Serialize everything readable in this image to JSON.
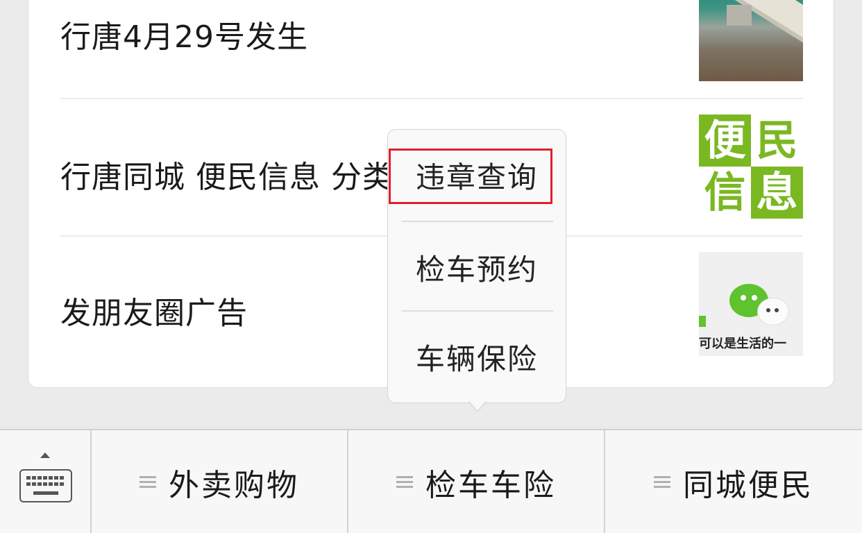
{
  "articles": [
    {
      "title": "行唐4月29号发生",
      "thumbnail": "bridge-construction-photo"
    },
    {
      "title": "行唐同城 便民信息 分类",
      "thumbnail": {
        "tiles": [
          "便",
          "民",
          "信",
          "息"
        ]
      }
    },
    {
      "title": "发朋友圈广告",
      "thumbnail": {
        "caption_text": "可以是生活的一",
        "icon": "wechat-logo"
      }
    }
  ],
  "popup_menu": {
    "items": [
      "违章查询",
      "检车预约",
      "车辆保险"
    ],
    "highlighted_index": 0,
    "highlight_color": "#e0202a"
  },
  "bottom_menu": {
    "keyboard_icon": "keyboard-icon",
    "tabs": [
      "外卖购物",
      "检车车险",
      "同城便民"
    ]
  },
  "colors": {
    "accent_green": "#7ab822",
    "background": "#ebebeb"
  }
}
